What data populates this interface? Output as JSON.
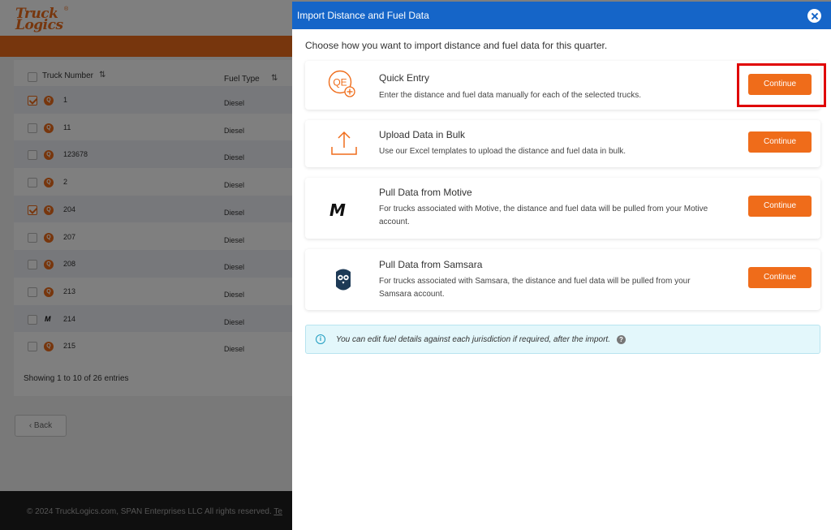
{
  "app": {
    "logo_line1": "Truck",
    "logo_line2": "Logics",
    "logo_reg": "®",
    "table": {
      "col_truck": "Truck Number",
      "col_fuel": "Fuel Type",
      "rows": [
        {
          "truck": "1",
          "fuel": "Diesel",
          "checked": true,
          "provider": "qe"
        },
        {
          "truck": "11",
          "fuel": "Diesel",
          "checked": false,
          "provider": "qe"
        },
        {
          "truck": "123678",
          "fuel": "Diesel",
          "checked": false,
          "provider": "qe"
        },
        {
          "truck": "2",
          "fuel": "Diesel",
          "checked": false,
          "provider": "qe"
        },
        {
          "truck": "204",
          "fuel": "Diesel",
          "checked": true,
          "provider": "qe"
        },
        {
          "truck": "207",
          "fuel": "Diesel",
          "checked": false,
          "provider": "qe"
        },
        {
          "truck": "208",
          "fuel": "Diesel",
          "checked": false,
          "provider": "qe"
        },
        {
          "truck": "213",
          "fuel": "Diesel",
          "checked": false,
          "provider": "qe"
        },
        {
          "truck": "214",
          "fuel": "Diesel",
          "checked": false,
          "provider": "motive"
        },
        {
          "truck": "215",
          "fuel": "Diesel",
          "checked": false,
          "provider": "qe"
        }
      ]
    },
    "showing": "Showing 1 to 10 of 26 entries",
    "back_label": "‹ Back",
    "footer": {
      "text": "© 2024 TruckLogics.com, SPAN Enterprises LLC All rights reserved.",
      "link": "Te"
    }
  },
  "modal": {
    "title": "Import Distance and Fuel Data",
    "intro": "Choose how you want to import distance and fuel data for this quarter.",
    "options": [
      {
        "icon": "quick-entry-icon",
        "title": "Quick Entry",
        "desc": "Enter the distance and fuel data manually for each of the selected trucks.",
        "button": "Continue"
      },
      {
        "icon": "upload-icon",
        "title": "Upload Data in Bulk",
        "desc": "Use our Excel templates to upload the distance and fuel data in bulk.",
        "button": "Continue"
      },
      {
        "icon": "motive-logo-icon",
        "title": "Pull Data from Motive",
        "desc": "For trucks associated with Motive, the distance and fuel data will be pulled from your Motive account.",
        "button": "Continue"
      },
      {
        "icon": "samsara-logo-icon",
        "title": "Pull Data from Samsara",
        "desc": "For trucks associated with Samsara, the distance and fuel data will be pulled from your Samsara account.",
        "button": "Continue"
      }
    ],
    "info": "You can edit fuel details against each jurisdiction if required, after the import.",
    "qe_icon_text": "QE",
    "motive_icon_text": "M",
    "info_icon_text": "i",
    "help_icon_text": "?"
  },
  "colors": {
    "accent": "#ef6c1a",
    "header_blue": "#1565c8",
    "highlight_red": "#e00000",
    "info_bg": "#e3f7fb"
  }
}
